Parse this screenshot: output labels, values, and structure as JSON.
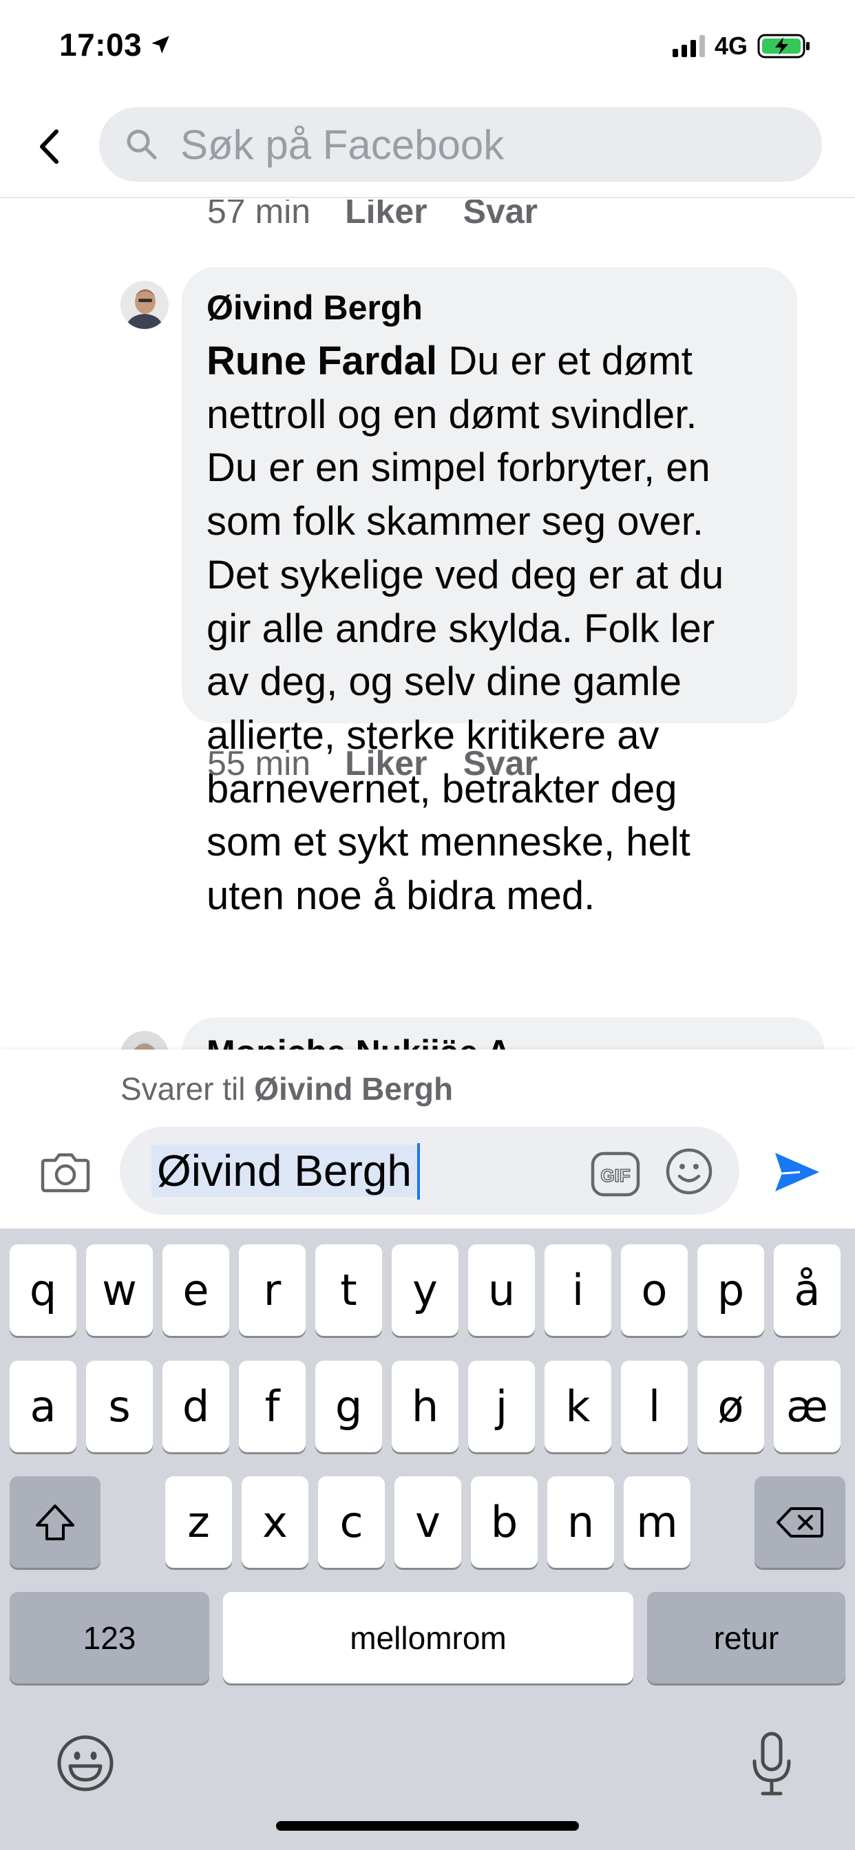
{
  "status_bar": {
    "time": "17:03",
    "network": "4G",
    "location_icon": "location-arrow-icon",
    "battery_icon": "battery-charging-icon"
  },
  "header": {
    "search_placeholder": "Søk på Facebook",
    "back_icon": "chevron-left-icon",
    "search_icon": "search-icon"
  },
  "comments": [
    {
      "time": "57 min",
      "like_label": "Liker",
      "reply_label": "Svar"
    },
    {
      "author": "Øivind Bergh",
      "mention": "Rune Fardal",
      "text_lines": [
        " Du er et dømt",
        "nettroll og en dømt svindler.",
        "Du er en simpel forbryter, en",
        "som folk skammer seg over.",
        "Det sykelige ved deg er at du",
        "gir alle andre skylda. Folk ler",
        "av deg, og selv dine gamle",
        "allierte, sterke kritikere av",
        "barnevernet, betrakter deg",
        "som et sykt menneske, helt",
        "uten noe å bidra med."
      ],
      "time": "55 min",
      "like_label": "Liker",
      "reply_label": "Svar"
    },
    {
      "author": "Monicha Nukiiäe A"
    }
  ],
  "composer": {
    "reply_prefix": "Svarer til ",
    "reply_to": "Øivind Bergh",
    "input_value": "Øivind Bergh",
    "camera_icon": "camera-icon",
    "gif_icon": "gif-icon",
    "emoji_icon": "smiley-icon",
    "send_icon": "send-icon"
  },
  "keyboard": {
    "row1": [
      "q",
      "w",
      "e",
      "r",
      "t",
      "y",
      "u",
      "i",
      "o",
      "p",
      "å"
    ],
    "row2": [
      "a",
      "s",
      "d",
      "f",
      "g",
      "h",
      "j",
      "k",
      "l",
      "ø",
      "æ"
    ],
    "row3": [
      "z",
      "x",
      "c",
      "v",
      "b",
      "n",
      "m"
    ],
    "numbers_label": "123",
    "space_label": "mellomrom",
    "return_label": "retur",
    "shift_icon": "shift-icon",
    "backspace_icon": "backspace-icon",
    "emoji_icon": "emoji-keyboard-icon",
    "mic_icon": "microphone-icon"
  },
  "colors": {
    "accent": "#1877f2",
    "bubble": "#f0f1f3",
    "secondary_text": "#65676b",
    "keyboard_bg": "#d2d5db",
    "function_key": "#abb0ba"
  }
}
